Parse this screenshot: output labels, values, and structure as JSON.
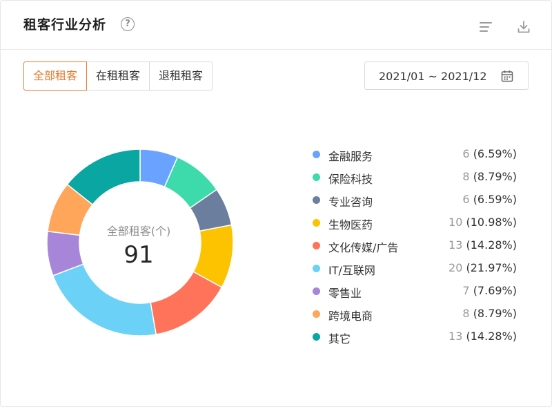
{
  "header": {
    "title": "租客行业分析",
    "help_icon": "question-circle-icon",
    "menu_icon": "list-icon",
    "download_icon": "download-icon"
  },
  "tabs": [
    {
      "label": "全部租客",
      "active": true
    },
    {
      "label": "在租租客",
      "active": false
    },
    {
      "label": "退租租客",
      "active": false
    }
  ],
  "date_range": {
    "text": "2021/01 ~ 2021/12",
    "icon": "calendar-icon"
  },
  "colors": {
    "accent": "#e57a2d"
  },
  "chart_data": {
    "type": "pie",
    "donut": true,
    "center_label": "全部租客(个)",
    "center_value": "91",
    "total": 91,
    "slices": [
      {
        "label": "金融服务",
        "value": 6,
        "percent": "(6.59%)",
        "color": "#6aa3ff"
      },
      {
        "label": "保险科技",
        "value": 8,
        "percent": "(8.79%)",
        "color": "#3ddbab"
      },
      {
        "label": "专业咨询",
        "value": 6,
        "percent": "(6.59%)",
        "color": "#6b7e9d"
      },
      {
        "label": "生物医药",
        "value": 10,
        "percent": "(10.98%)",
        "color": "#fdc300"
      },
      {
        "label": "文化传媒/广告",
        "value": 13,
        "percent": "(14.28%)",
        "color": "#ff735a"
      },
      {
        "label": "IT/互联网",
        "value": 20,
        "percent": "(21.97%)",
        "color": "#6bd1f6"
      },
      {
        "label": "零售业",
        "value": 7,
        "percent": "(7.69%)",
        "color": "#a786d9"
      },
      {
        "label": "跨境电商",
        "value": 8,
        "percent": "(8.79%)",
        "color": "#ffa65a"
      },
      {
        "label": "其它",
        "value": 13,
        "percent": "(14.28%)",
        "color": "#0aa6a1"
      }
    ]
  }
}
